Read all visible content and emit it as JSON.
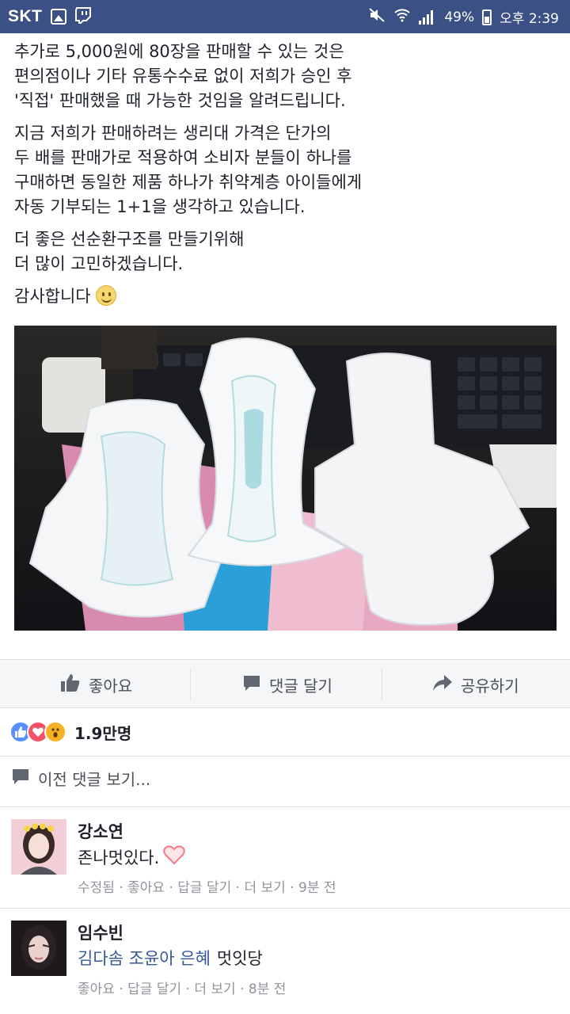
{
  "status_bar": {
    "carrier": "SKT",
    "battery": "49%",
    "time": "오후 2:39"
  },
  "post": {
    "paragraphs": [
      [
        "추가로 5,000원에 80장을 판매할 수 있는 것은",
        "편의점이나 기타 유통수수료 없이 저희가 승인 후",
        "'직접' 판매했을 때 가능한 것임을 알려드립니다."
      ],
      [
        "지금 저희가 판매하려는 생리대 가격은 단가의",
        "두 배를 판매가로 적용하여 소비자 분들이 하나를",
        "구매하면 동일한 제품 하나가 취약계층 아이들에게",
        "자동 기부되는 1+1을 생각하고 있습니다."
      ],
      [
        "더 좋은 선순환구조를 만들기위해",
        "더 많이 고민하겠습니다."
      ]
    ],
    "closing": "감사합니다",
    "closing_emoji": "smile-emoji"
  },
  "actions": {
    "like": "좋아요",
    "comment": "댓글 달기",
    "share": "공유하기"
  },
  "reactions": {
    "types": [
      "like",
      "love",
      "wow"
    ],
    "count": "1.9만명"
  },
  "previous_comments": "이전 댓글 보기...",
  "comments": [
    {
      "name": "강소연",
      "text": "존나멋있다.",
      "has_heart": true,
      "meta": [
        "수정됨",
        "좋아요",
        "답글 달기",
        "더 보기",
        "9분 전"
      ]
    },
    {
      "name": "임수빈",
      "tags": "김다솜 조윤아 은혜",
      "text": "멋잇당",
      "meta": [
        "좋아요",
        "답글 달기",
        "더 보기",
        "8분 전"
      ]
    }
  ],
  "colors": {
    "status_bar": "#3b5084",
    "text": "#1d2129",
    "secondary": "#4b4f56",
    "meta": "#90949c",
    "link": "#365899"
  }
}
